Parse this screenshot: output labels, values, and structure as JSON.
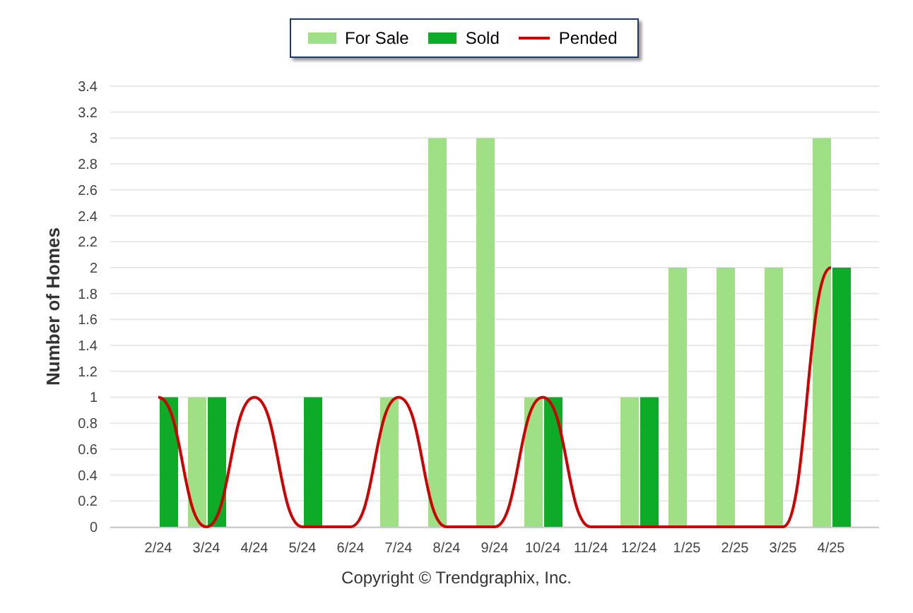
{
  "chart_data": {
    "type": "bar",
    "ylabel": "Number of Homes",
    "categories": [
      "2/24",
      "3/24",
      "4/24",
      "5/24",
      "6/24",
      "7/24",
      "8/24",
      "9/24",
      "10/24",
      "11/24",
      "12/24",
      "1/25",
      "2/25",
      "3/25",
      "4/25"
    ],
    "series": [
      {
        "name": "For Sale",
        "color": "#9fdf86",
        "values": [
          0,
          1,
          0,
          0,
          0,
          1,
          3,
          3,
          1,
          0,
          1,
          2,
          2,
          2,
          3
        ]
      },
      {
        "name": "Sold",
        "color": "#0dab27",
        "values": [
          1,
          1,
          0,
          1,
          0,
          0,
          0,
          0,
          1,
          0,
          1,
          0,
          0,
          0,
          2
        ]
      },
      {
        "name": "Pended",
        "type": "line",
        "color": "#cc0000",
        "values": [
          1,
          0,
          1,
          0,
          0,
          1,
          0,
          0,
          1,
          0,
          0,
          0,
          0,
          0,
          2
        ]
      }
    ],
    "grid": true,
    "ylim": [
      0,
      3.4
    ],
    "yticks": [
      0,
      0.2,
      0.4,
      0.6,
      0.8,
      1,
      1.2,
      1.4,
      1.6,
      1.8,
      2,
      2.2,
      2.4,
      2.6,
      2.8,
      3,
      3.2,
      3.4
    ]
  },
  "footer": "Copyright © Trendgraphix, Inc."
}
